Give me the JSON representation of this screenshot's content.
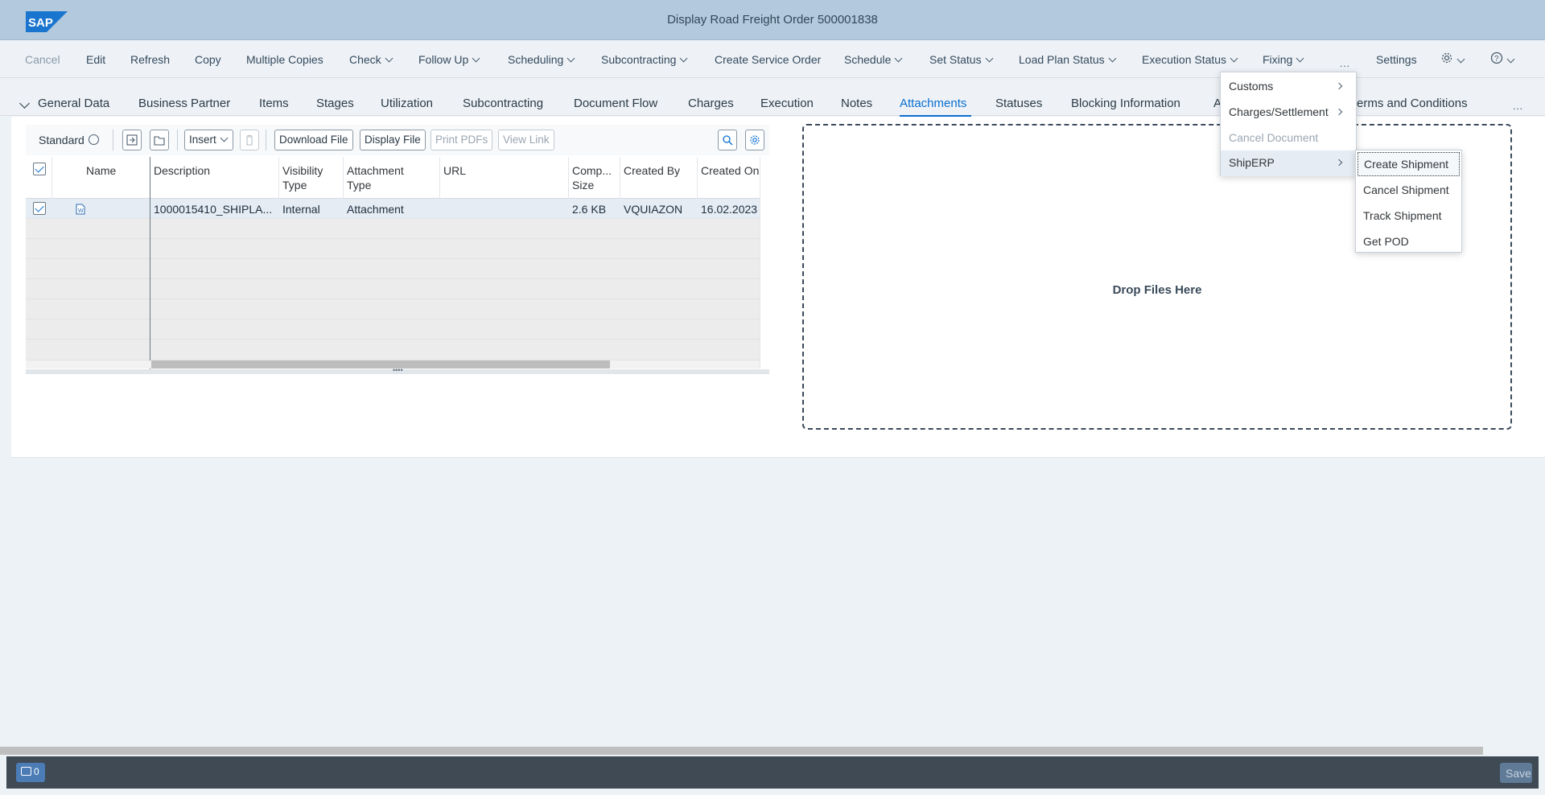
{
  "shell": {
    "title": "Display Road Freight Order 500001838",
    "logo": "SAP"
  },
  "toolbar": {
    "cancel": "Cancel",
    "edit": "Edit",
    "refresh": "Refresh",
    "copy": "Copy",
    "multiple_copies": "Multiple Copies",
    "check": "Check",
    "follow_up": "Follow Up",
    "scheduling": "Scheduling",
    "subcontracting": "Subcontracting",
    "create_service_order": "Create Service Order",
    "schedule": "Schedule",
    "set_status": "Set Status",
    "load_plan_status": "Load Plan Status",
    "execution_status": "Execution Status",
    "fixing": "Fixing",
    "overflow": "...",
    "settings": "Settings"
  },
  "tabs": {
    "general_data": "General Data",
    "business_partner": "Business Partner",
    "items": "Items",
    "stages": "Stages",
    "utilization": "Utilization",
    "subcontracting": "Subcontracting",
    "document_flow": "Document Flow",
    "charges": "Charges",
    "execution": "Execution",
    "notes": "Notes",
    "attachments": "Attachments",
    "statuses": "Statuses",
    "blocking_information": "Blocking Information",
    "a_partial": "A",
    "terms_partial": "erms and Conditions",
    "more": "..."
  },
  "table_toolbar": {
    "variant": "Standard",
    "insert": "Insert",
    "download_file": "Download File",
    "display_file": "Display File",
    "print_pdfs": "Print PDFs",
    "view_link": "View Link"
  },
  "table": {
    "headers": {
      "name": "Name",
      "description": "Description",
      "visibility_type_1": "Visibility",
      "visibility_type_2": "Type",
      "attachment_type_1": "Attachment",
      "attachment_type_2": "Type",
      "url": "URL",
      "comp_size_1": "Comp...",
      "comp_size_2": "Size",
      "created_by": "Created By",
      "created_on": "Created On"
    },
    "rows": [
      {
        "description": "1000015410_SHIPLA...",
        "visibility_type": "Internal",
        "attachment_type": "Attachment",
        "url": "",
        "size": "2.6 KB",
        "created_by": "VQUIAZON",
        "created_on": "16.02.2023"
      }
    ]
  },
  "dropzone": {
    "text": "Drop Files Here"
  },
  "menu_more": {
    "customs": "Customs",
    "charges_settlement": "Charges/Settlement",
    "cancel_document": "Cancel Document",
    "shiperp": "ShipERP"
  },
  "menu_shiperp": {
    "create_shipment": "Create Shipment",
    "cancel_shipment": "Cancel Shipment",
    "track_shipment": "Track Shipment",
    "get_pod": "Get POD"
  },
  "footer": {
    "messages_count": "0",
    "save": "Save"
  },
  "colors": {
    "shell": "#b3c9dd",
    "accent": "#0a6ed1",
    "footer": "#3f4a55"
  },
  "icons": {
    "attachment_file": "word-document-icon",
    "search": "search-icon",
    "table_settings": "gear-icon",
    "delete": "trash-icon",
    "help": "help-icon",
    "personalize": "gear-icon",
    "messages": "message-icon"
  }
}
